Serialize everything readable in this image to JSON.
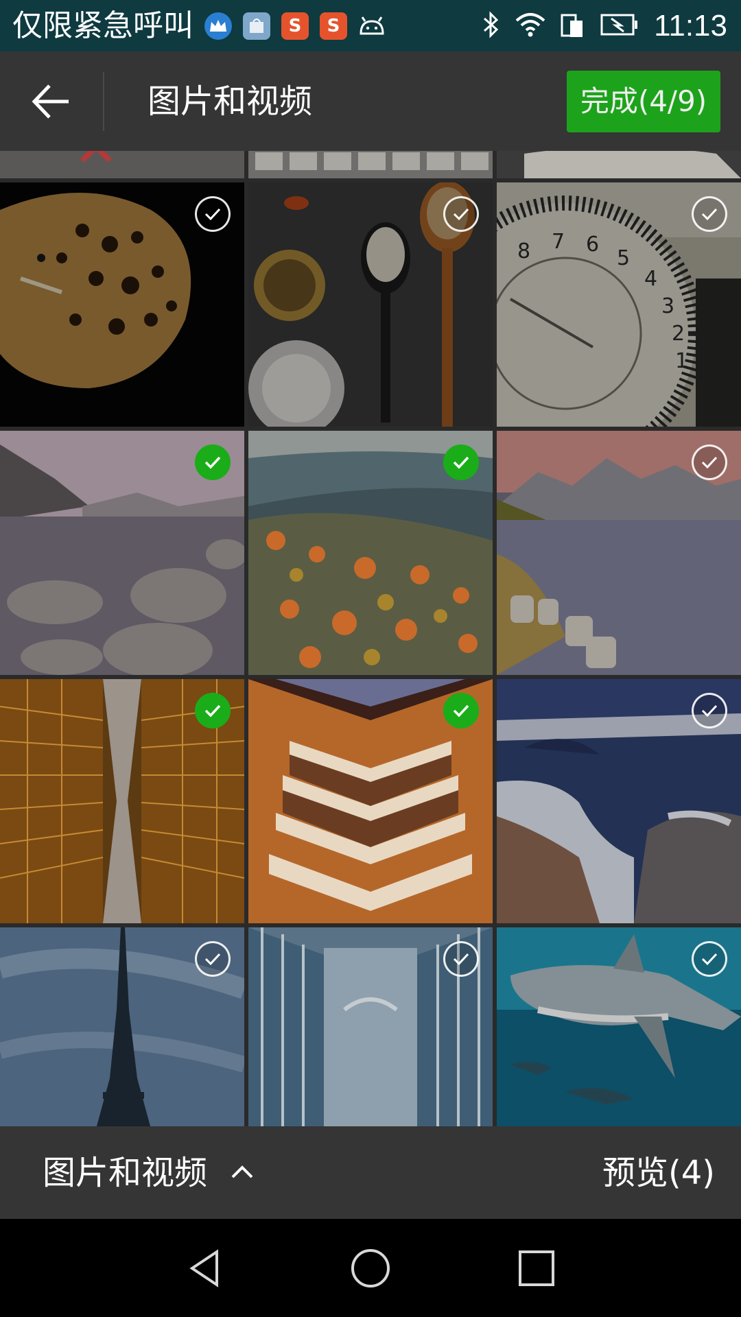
{
  "status_bar": {
    "carrier": "仅限紧急呼叫",
    "time": "11:13",
    "notif_icons": [
      "crown-app-icon",
      "store-app-icon",
      "sogou-s-icon",
      "sogou-s-icon",
      "android-icon"
    ],
    "sys_icons": [
      "bluetooth-icon",
      "wifi-icon",
      "sim-icon",
      "battery-charging-icon"
    ]
  },
  "app_bar": {
    "back_icon": "arrow-left-icon",
    "title": "图片和视频",
    "done_label": "完成(4/9)",
    "accent_color": "#1aad19"
  },
  "grid": {
    "columns": 3,
    "items": [
      {
        "subject": "leopard",
        "selected": false
      },
      {
        "subject": "spices on spoons",
        "selected": false
      },
      {
        "subject": "camera dial",
        "selected": false
      },
      {
        "subject": "mountain lake with rocks",
        "selected": true
      },
      {
        "subject": "autumn valley",
        "selected": true
      },
      {
        "subject": "alpine lake sunset",
        "selected": false
      },
      {
        "subject": "golden skyscrapers",
        "selected": true
      },
      {
        "subject": "opera house stairs",
        "selected": true
      },
      {
        "subject": "crater lake driftwood",
        "selected": false
      },
      {
        "subject": "eiffel tower",
        "selected": false
      },
      {
        "subject": "glass corridor",
        "selected": false
      },
      {
        "subject": "shark",
        "selected": false
      }
    ]
  },
  "bottom_bar": {
    "album_label": "图片和视频",
    "album_icon": "caret-up-icon",
    "preview_label": "预览(4)"
  },
  "nav_bar": {
    "icons": [
      "nav-back-icon",
      "nav-home-icon",
      "nav-recents-icon"
    ]
  }
}
